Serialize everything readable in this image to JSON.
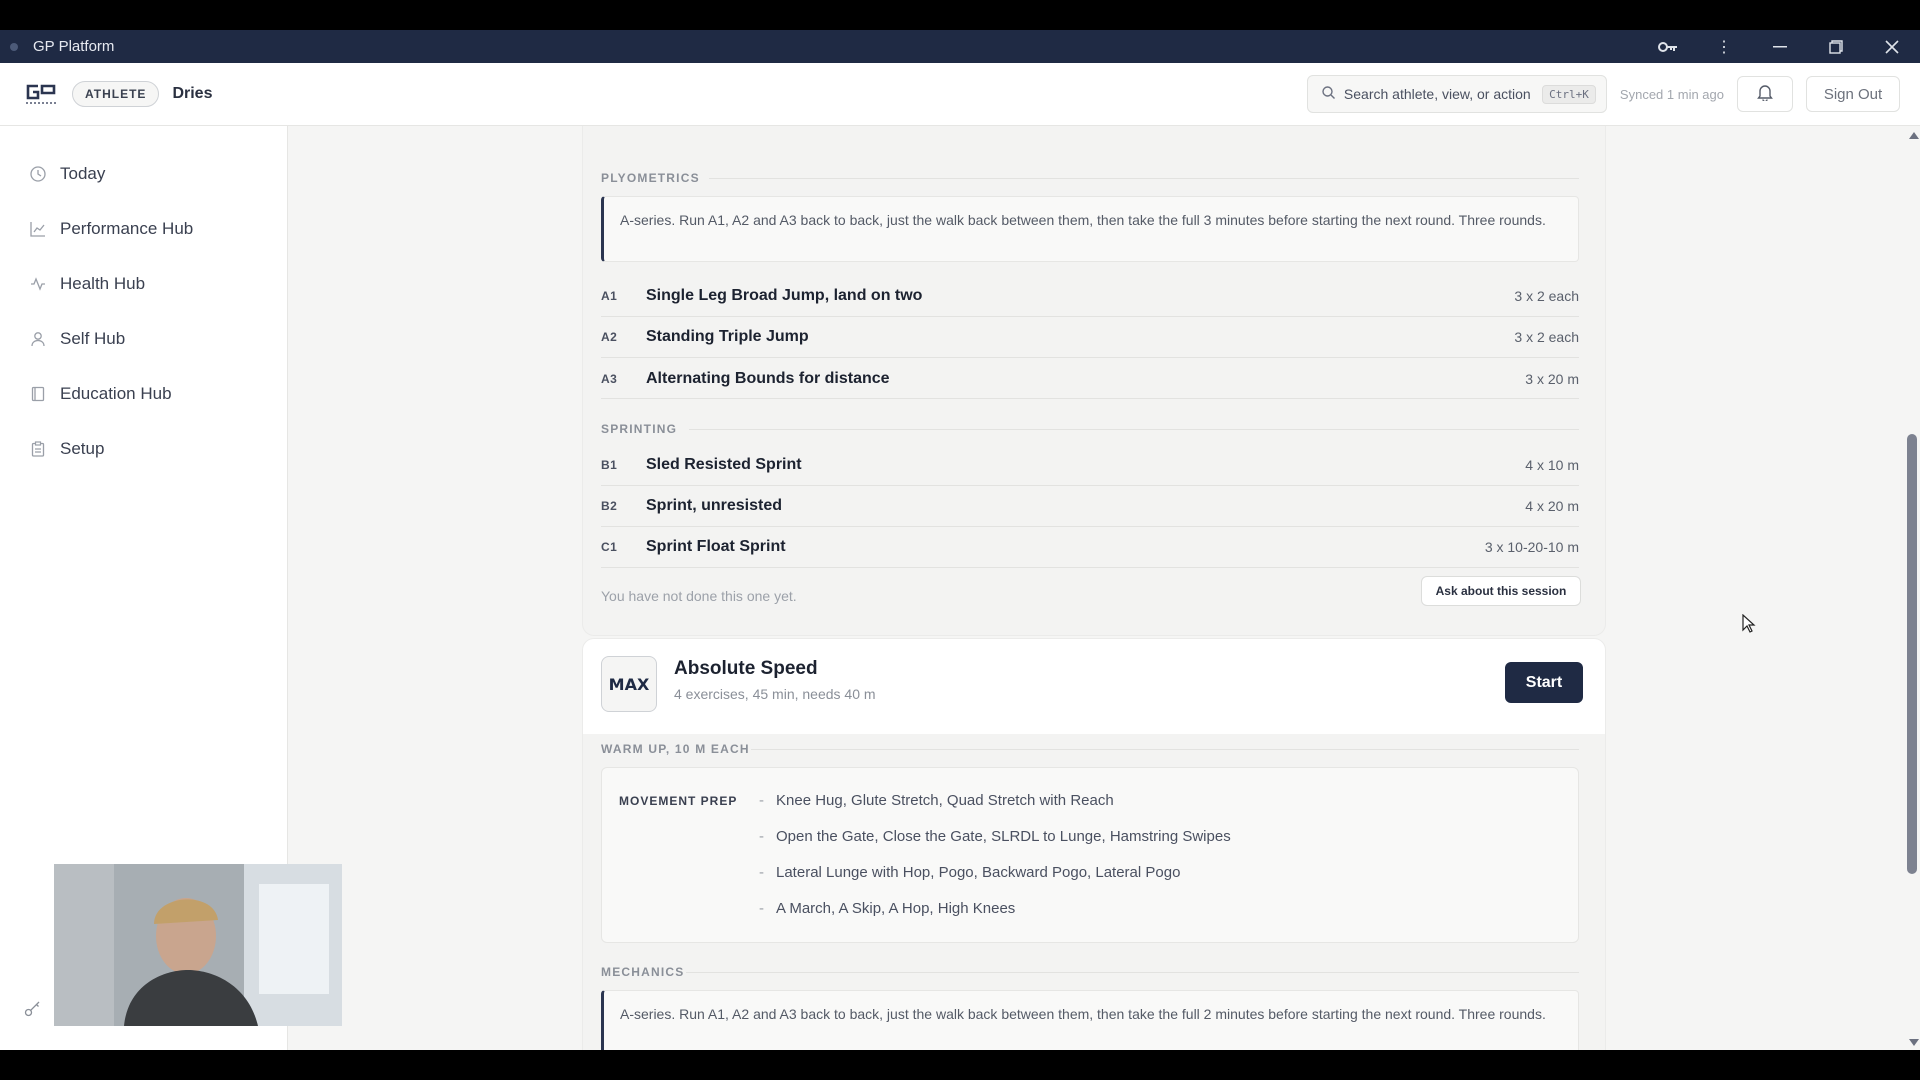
{
  "window": {
    "title": "GP Platform"
  },
  "header": {
    "role": "ATHLETE",
    "user": "Dries",
    "search_placeholder": "Search athlete, view, or action",
    "search_shortcut": "Ctrl+K",
    "synced": "Synced 1 min ago",
    "sign_out": "Sign Out"
  },
  "sidebar": {
    "items": [
      {
        "label": "Today",
        "icon": "clock-icon"
      },
      {
        "label": "Performance Hub",
        "icon": "chart-icon"
      },
      {
        "label": "Health Hub",
        "icon": "pulse-icon"
      },
      {
        "label": "Self Hub",
        "icon": "person-icon"
      },
      {
        "label": "Education Hub",
        "icon": "book-icon"
      },
      {
        "label": "Setup",
        "icon": "clipboard-icon"
      }
    ]
  },
  "session1": {
    "plyometrics_label": "PLYOMETRICS",
    "plyometrics_note": "A-series. Run A1, A2 and A3 back to back, just the walk back between them, then take the full 3 minutes before starting the next round. Three rounds.",
    "plyometrics": [
      {
        "code": "A1",
        "name": "Single Leg Broad Jump, land on two",
        "dose": "3 x 2 each"
      },
      {
        "code": "A2",
        "name": "Standing Triple Jump",
        "dose": "3 x 2 each"
      },
      {
        "code": "A3",
        "name": "Alternating Bounds for distance",
        "dose": "3 x 20 m"
      }
    ],
    "sprinting_label": "SPRINTING",
    "sprinting": [
      {
        "code": "B1",
        "name": "Sled Resisted Sprint",
        "dose": "4 x 10 m"
      },
      {
        "code": "B2",
        "name": "Sprint, unresisted",
        "dose": "4 x 20 m"
      },
      {
        "code": "C1",
        "name": "Sprint Float Sprint",
        "dose": "3 x 10-20-10 m"
      }
    ],
    "status": "You have not done this one yet.",
    "ask_button": "Ask about this session"
  },
  "session2": {
    "badge": "MAX",
    "title": "Absolute Speed",
    "subtitle": "4 exercises, 45 min, needs 40 m",
    "start_button": "Start",
    "warmup_label": "WARM UP, 10 M EACH",
    "movement_prep_label": "MOVEMENT PREP",
    "movement_prep": [
      "Knee Hug, Glute Stretch, Quad Stretch with Reach",
      "Open the Gate, Close the Gate, SLRDL to Lunge, Hamstring Swipes",
      "Lateral Lunge with Hop, Pogo, Backward Pogo, Lateral Pogo",
      "A March, A Skip, A Hop, High Knees"
    ],
    "mechanics_label": "MECHANICS",
    "mechanics_note": "A-series. Run A1, A2 and A3 back to back, just the walk back between them, then take the full 2 minutes before starting the next round. Three rounds."
  },
  "colors": {
    "navy": "#1f2a44",
    "background": "#f5f5f4"
  }
}
